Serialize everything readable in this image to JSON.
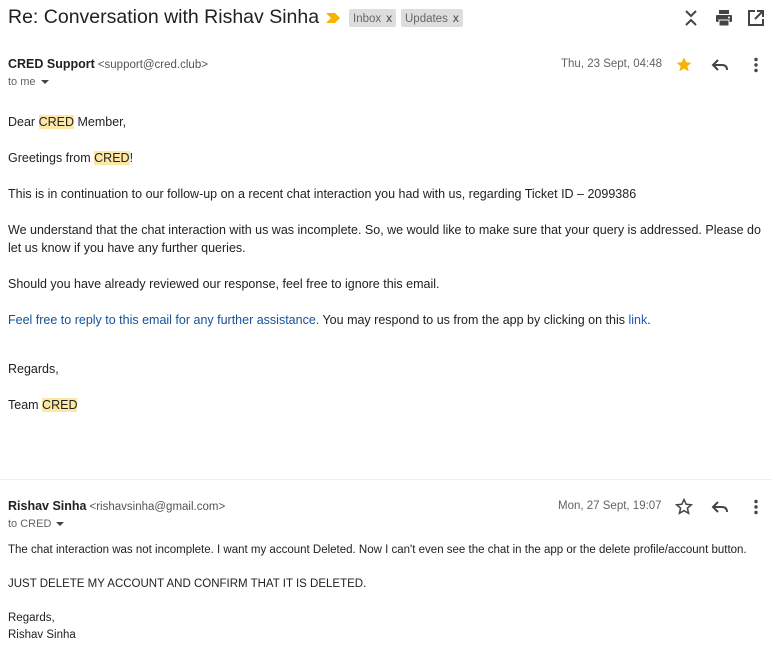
{
  "subject": "Re: Conversation with Rishav Sinha",
  "labels": [
    {
      "name": "Inbox",
      "remove": "x"
    },
    {
      "name": "Updates",
      "remove": "x"
    }
  ],
  "toolbar_icons": [
    "collapse-icon",
    "print-icon",
    "open-in-new-window-icon"
  ],
  "messages": [
    {
      "sender_name": "CRED Support",
      "sender_email": "<support@cred.club>",
      "to": "to me",
      "date": "Thu, 23 Sept, 04:48",
      "starred": true,
      "body": {
        "greeting_prefix": "Dear ",
        "greeting_highlight": "CRED",
        "greeting_suffix": " Member,",
        "greetings_prefix": "Greetings from ",
        "greetings_highlight": "CRED",
        "greetings_suffix": "!",
        "para1": "This is in continuation to our follow-up on a recent chat interaction you had with us, regarding Ticket ID – 2099386",
        "para2": "We understand that the chat interaction with us was incomplete. So, we would like to make sure that your query is addressed. Please do let us know if you have any further queries.",
        "para3": "Should you have already reviewed our response, feel free to ignore this email.",
        "para4_blue": "Feel free to reply to this email for any further assistance.",
        "para4_rest": " You may respond to us from the app by clicking on this ",
        "para4_link": "link",
        "para4_end": ".",
        "regards": "Regards,",
        "team_prefix": "Team ",
        "team_highlight": "CRED"
      }
    },
    {
      "sender_name": "Rishav Sinha",
      "sender_email": "<rishavsinha@gmail.com>",
      "to": "to CRED",
      "date": "Mon, 27 Sept, 19:07",
      "starred": false,
      "body": {
        "line1": "The chat interaction was not incomplete. I want my account Deleted. Now I can't even see the chat in the app or the delete profile/account button.",
        "line2": "JUST DELETE MY ACCOUNT AND CONFIRM THAT IT IS DELETED.",
        "line3": "Regards,",
        "line4": "Rishav Sinha"
      }
    }
  ],
  "colors": {
    "star_on": "#f4b400",
    "importance": "#f4b400",
    "chip_bg": "#dddddd",
    "highlight": "#fce8a4",
    "link": "#1a56c4"
  }
}
